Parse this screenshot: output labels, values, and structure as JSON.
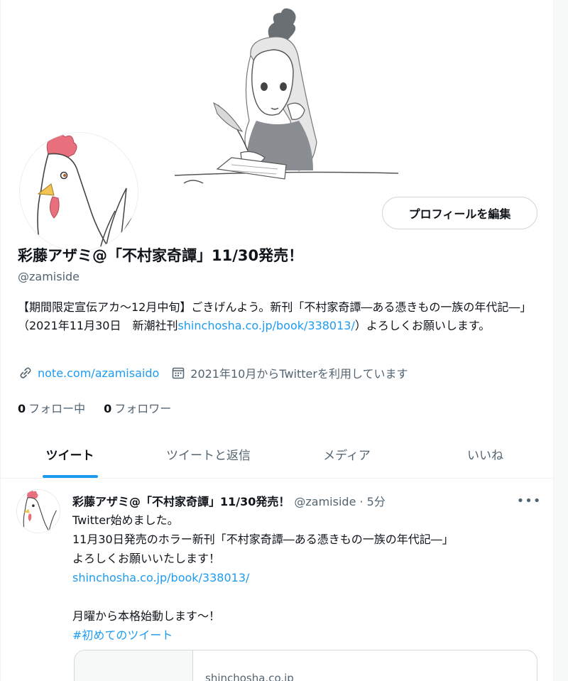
{
  "profile": {
    "edit_button": "プロフィールを編集",
    "name": "彩藤アザミ@「不村家奇譚」11/30発売！",
    "handle": "@zamiside",
    "bio_text": "【期間限定宣伝アカ〜12月中旬】ごきげんよう。新刊「不村家奇譚―ある憑きもの一族の年代記―」（2021年11月30日　新潮社刊",
    "bio_link": "shinchosha.co.jp/book/338013/",
    "bio_tail": "）よろしくお願いします。",
    "website": "note.com/azamisaido",
    "joined": "2021年10月からTwitterを利用しています",
    "following_count": "0",
    "following_label": "フォロー中",
    "followers_count": "0",
    "followers_label": "フォロワー",
    "icons": {
      "link": "link-icon",
      "calendar": "calendar-icon"
    }
  },
  "tabs": [
    {
      "label": "ツイート",
      "active": true
    },
    {
      "label": "ツイートと返信",
      "active": false
    },
    {
      "label": "メディア",
      "active": false
    },
    {
      "label": "いいね",
      "active": false
    }
  ],
  "tweet": {
    "author_name": "彩藤アザミ@「不村家奇譚」11/30発売！",
    "author_meta": "@zamiside · 5分",
    "more": "•••",
    "line1": "Twitter始めました。",
    "line2": "11月30日発売のホラー新刊「不村家奇譚―ある憑きもの一族の年代記―」",
    "line3": "よろしくお願いいたします！",
    "link": "shinchosha.co.jp/book/338013/",
    "line4": "月曜から本格始動します〜！",
    "hashtag": " #初めてのツイート",
    "card_domain": "shinchosha.co.jp"
  },
  "colors": {
    "accent": "#1d9bf0",
    "text": "#0f1419",
    "secondary": "#536471",
    "border": "#cfd9de"
  }
}
